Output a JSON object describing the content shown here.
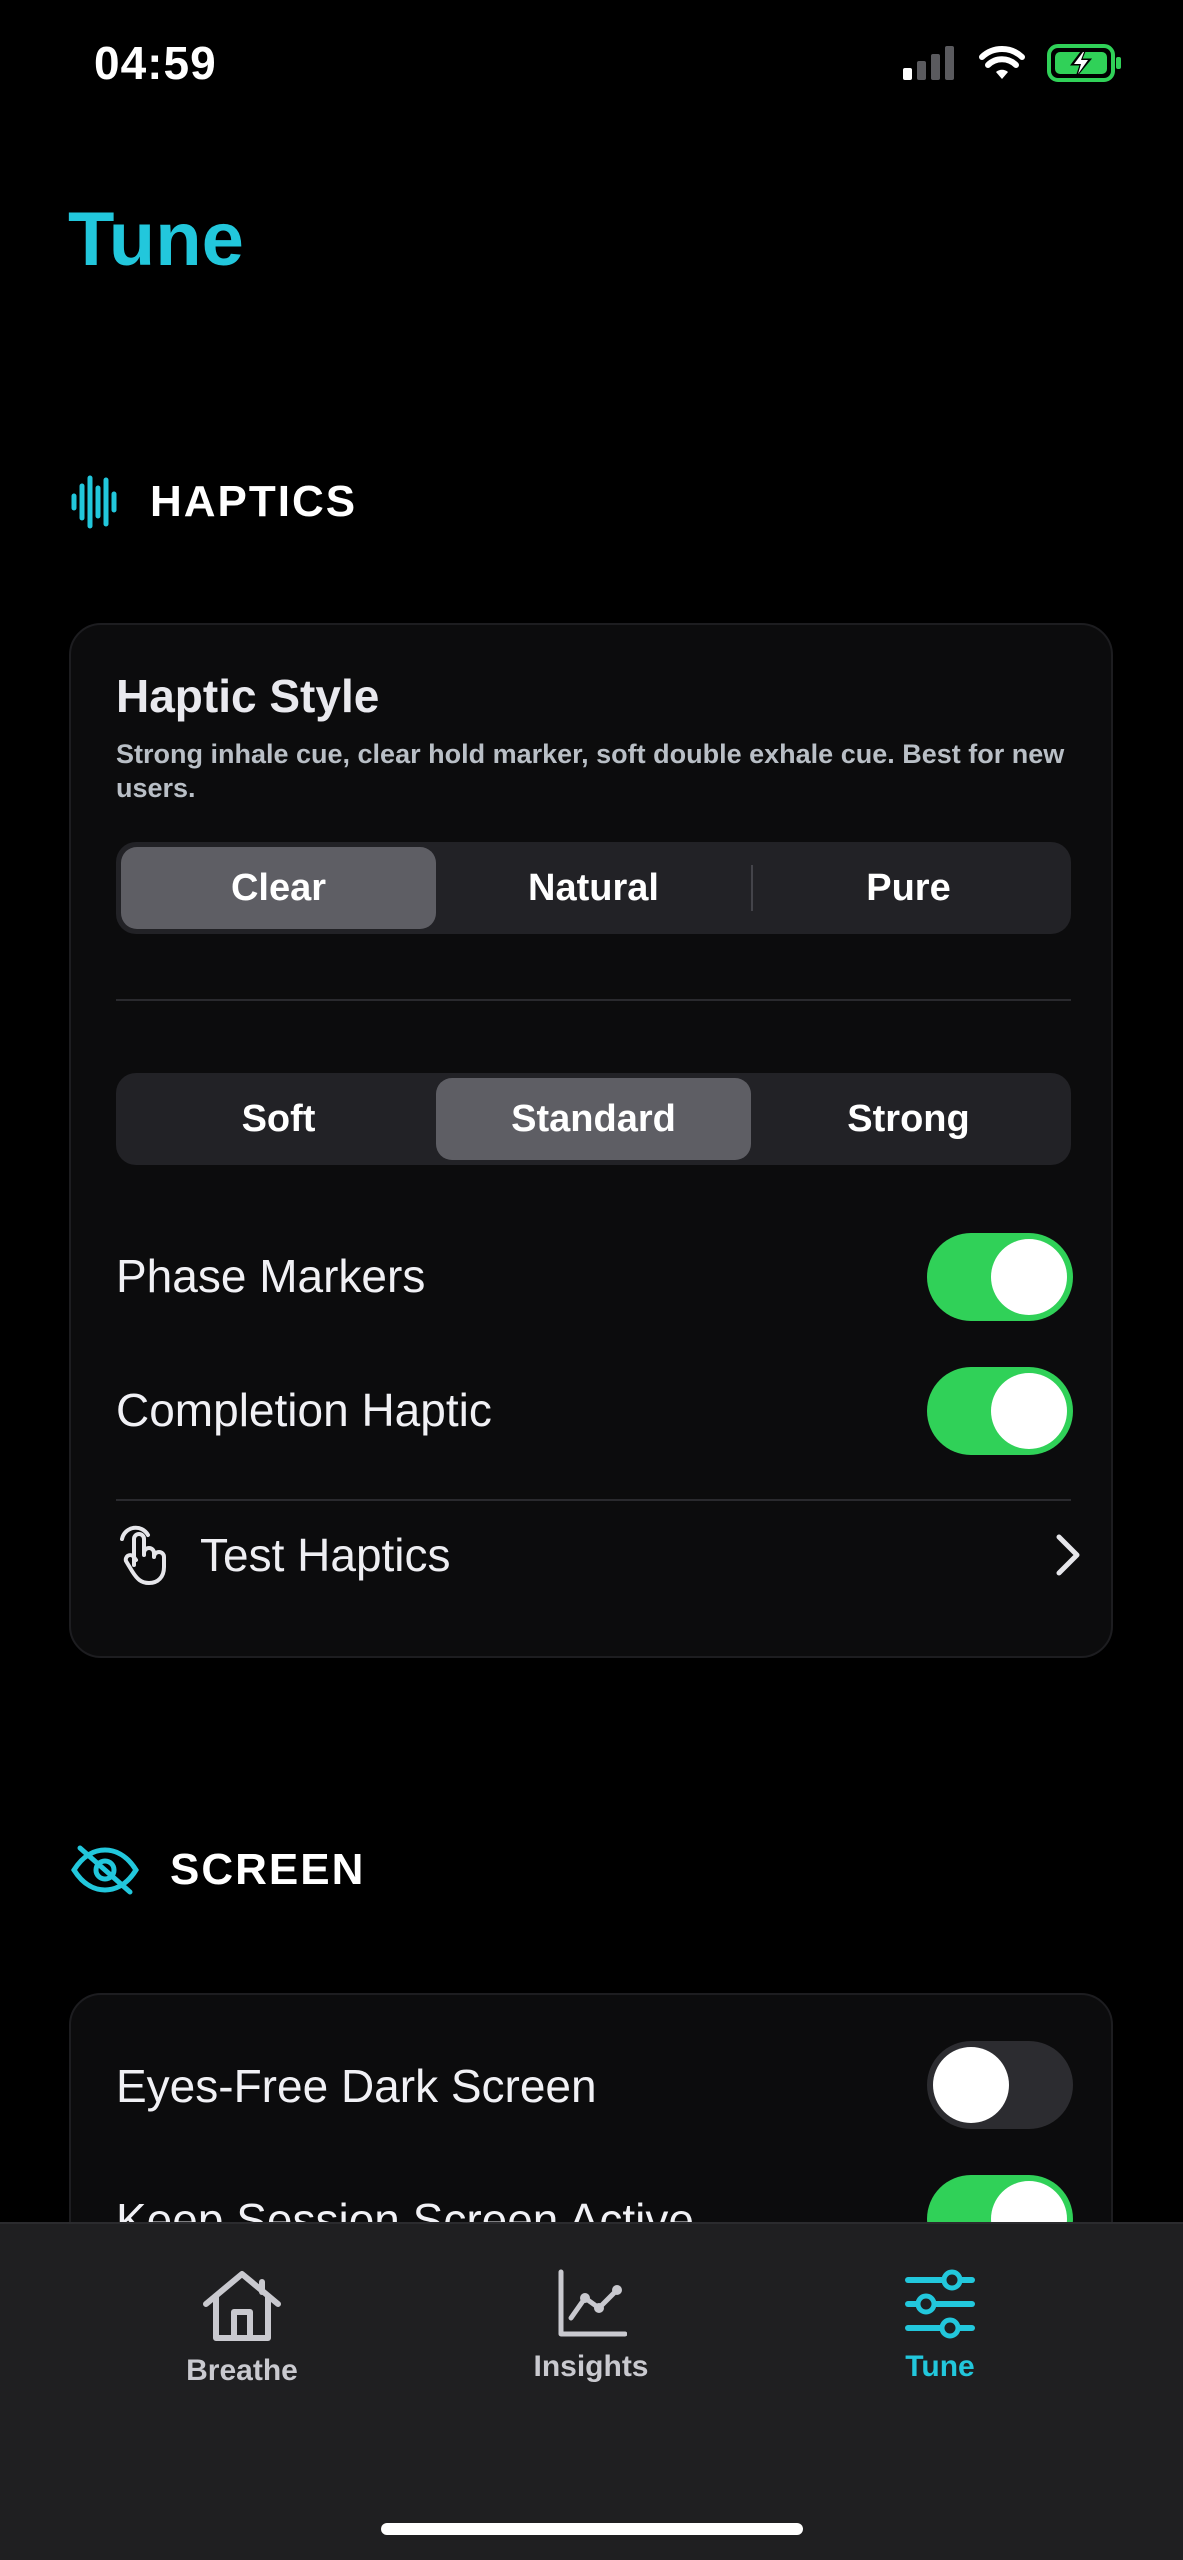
{
  "status_bar": {
    "time": "04:59"
  },
  "page_title": "Tune",
  "haptics_section": {
    "header": "HAPTICS",
    "style_title": "Haptic Style",
    "style_description": "Strong inhale cue, clear hold marker, soft double exhale cue. Best for new users.",
    "style_options": [
      "Clear",
      "Natural",
      "Pure"
    ],
    "style_selected": "Clear",
    "intensity_options": [
      "Soft",
      "Standard",
      "Strong"
    ],
    "intensity_selected": "Standard",
    "phase_markers_label": "Phase Markers",
    "phase_markers_on": true,
    "completion_label": "Completion Haptic",
    "completion_on": true,
    "test_label": "Test Haptics"
  },
  "screen_section": {
    "header": "SCREEN",
    "eyes_free_label": "Eyes-Free Dark Screen",
    "eyes_free_on": false,
    "keep_active_label": "Keep Session Screen Active",
    "keep_active_on": true
  },
  "tabbar": {
    "tabs": [
      {
        "label": "Breathe",
        "icon": "house-icon"
      },
      {
        "label": "Insights",
        "icon": "chart-line-icon"
      },
      {
        "label": "Tune",
        "icon": "sliders-icon"
      }
    ],
    "active": "Tune"
  },
  "colors": {
    "accent": "#22c7dc",
    "toggle_on": "#30d158",
    "background": "#000000",
    "card": "#0c0c0d"
  }
}
